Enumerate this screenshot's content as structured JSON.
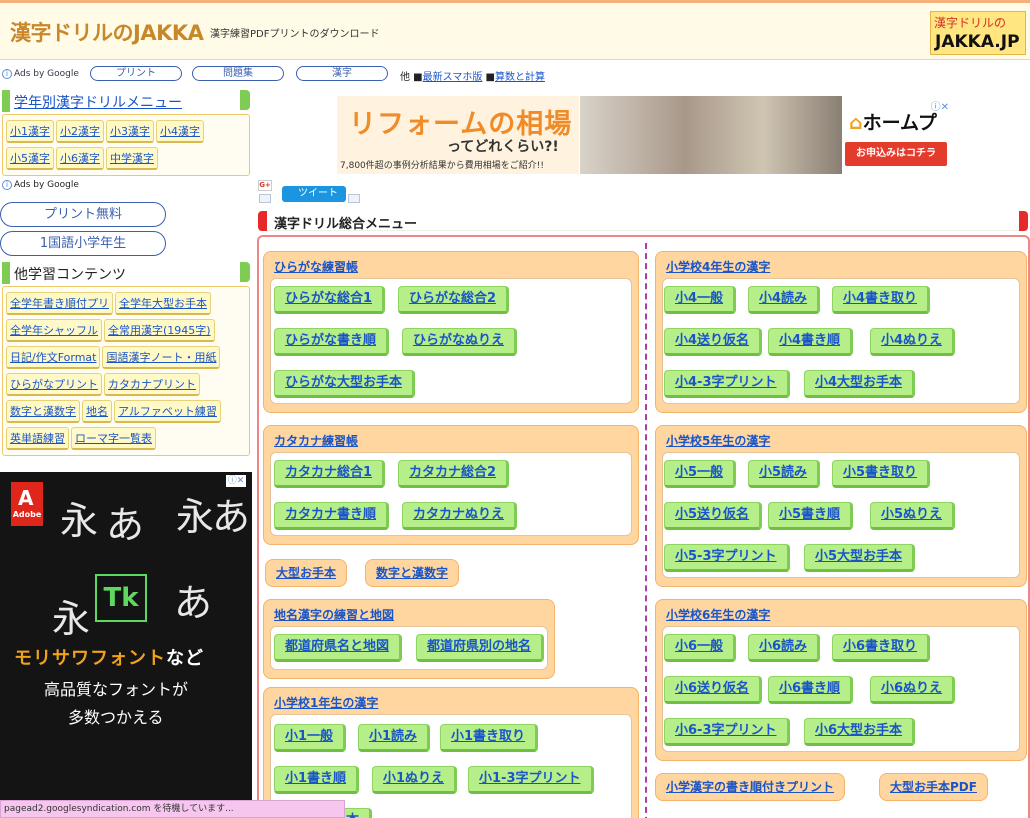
{
  "header": {
    "site_title": "漢字ドリルのJAKKA",
    "subtitle": "漢字練習PDFプリントのダウンロード",
    "logo_line1": "漢字ドリルの",
    "logo_line2": "JAKKA.JP"
  },
  "ads_row": {
    "ads_by": "Ads by Google",
    "pills": [
      "プリント",
      "問題集",
      "漢字"
    ],
    "other": "他",
    "links": [
      "最新スマホ版",
      "算数と計算"
    ]
  },
  "sidebar": {
    "section1_title": "学年別漢字ドリルメニュー",
    "grade_links": [
      "小1漢字",
      "小2漢字",
      "小3漢字",
      "小4漢字",
      "小5漢字",
      "小6漢字",
      "中学漢字"
    ],
    "ads_by": "Ads by Google",
    "ad_pills": [
      "プリント無料",
      "1国語小学年生"
    ],
    "section2_title": "他学習コンテンツ",
    "other_links": [
      "全学年書き順付プリ",
      "全学年大型お手本",
      "全学年シャッフル",
      "全常用漢字(1945字)",
      "日記/作文Format",
      "国語漢字ノート・用紙",
      "ひらがなプリント",
      "カタカナプリント",
      "数字と漢数字",
      "地名",
      "アルファベット練習",
      "英単語練習",
      "ローマ字一覧表"
    ]
  },
  "font_ad": {
    "adobe": "Adobe",
    "tk": "Tk",
    "line1_a": "モリサワフォント",
    "line1_b": "など",
    "line2": "高品質なフォントが",
    "line3": "多数つかえる",
    "glyphs": [
      "永",
      "あ",
      "永",
      "あ",
      "永",
      "あ"
    ]
  },
  "banner": {
    "title": "リフォームの相場",
    "sub": "ってどれくらい?!",
    "note": "7,800件超の事例分析結果から費用相場をご紹介!!",
    "brand": "ホームプロ",
    "cta": "お申込みはコチラ"
  },
  "social": {
    "gplus": "G+",
    "tweet": "ツイート"
  },
  "main": {
    "menu_title": "漢字ドリル総合メニュー",
    "hiragana": {
      "title": "ひらがな練習帳",
      "buttons": [
        "ひらがな総合1",
        "ひらがな総合2",
        "ひらがな書き順",
        "ひらがなぬりえ",
        "ひらがな大型お手本"
      ]
    },
    "katakana": {
      "title": "カタカナ練習帳",
      "buttons": [
        "カタカナ総合1",
        "カタカナ総合2",
        "カタカナ書き順",
        "カタカナぬりえ"
      ]
    },
    "misc_buttons": [
      "大型お手本",
      "数字と漢数字"
    ],
    "chimei": {
      "title": "地名漢字の練習と地図",
      "buttons": [
        "都道府県名と地図",
        "都道府県別の地名"
      ]
    },
    "grade1": {
      "title": "小学校1年生の漢字",
      "buttons": [
        "小1一般",
        "小1読み",
        "小1書き取り",
        "小1書き順",
        "小1ぬりえ",
        "小1-3字プリント"
      ]
    },
    "grade1_partial": "手本",
    "grade4": {
      "title": "小学校4年生の漢字",
      "buttons": [
        "小4一般",
        "小4読み",
        "小4書き取り",
        "小4送り仮名",
        "小4書き順",
        "小4ぬりえ",
        "小4-3字プリント",
        "小4大型お手本"
      ]
    },
    "grade5": {
      "title": "小学校5年生の漢字",
      "buttons": [
        "小5一般",
        "小5読み",
        "小5書き取り",
        "小5送り仮名",
        "小5書き順",
        "小5ぬりえ",
        "小5-3字プリント",
        "小5大型お手本"
      ]
    },
    "grade6": {
      "title": "小学校6年生の漢字",
      "buttons": [
        "小6一般",
        "小6読み",
        "小6書き取り",
        "小6送り仮名",
        "小6書き順",
        "小6ぬりえ",
        "小6-3字プリント",
        "小6大型お手本"
      ]
    },
    "bottom_buttons": [
      "小学漢字の書き順付きプリント",
      "大型お手本PDF"
    ]
  },
  "status_bar": "pagead2.googlesyndication.com を待機しています..."
}
